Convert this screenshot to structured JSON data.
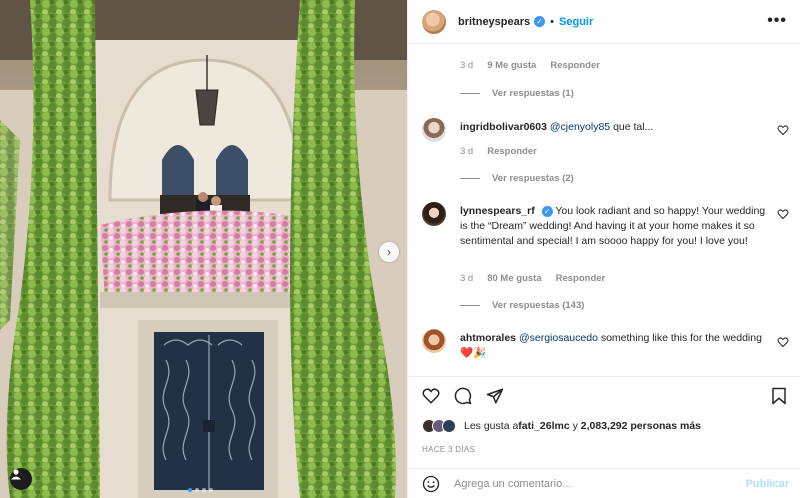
{
  "post": {
    "username": "britneyspears",
    "follow_label": "Seguir",
    "separator": "•",
    "more_label": "•••",
    "next_icon": "chevron-right-icon"
  },
  "comments": {
    "c0_meta": {
      "age": "3 d",
      "likes": "9 Me gusta",
      "reply": "Responder"
    },
    "c0_view_replies": "Ver respuestas (1)",
    "c1": {
      "username": "ingridbolivar0603",
      "mention": "@cjenyoly85",
      "text": " que tal...",
      "age": "3 d",
      "reply": "Responder",
      "view_replies": "Ver respuestas (2)"
    },
    "c2": {
      "username": "lynnespears_rf",
      "text": " You look radiant and so happy! Your wedding is the “Dream” wedding! And having it at your home makes it so sentimental and special! I am soooo happy for you! I love you!",
      "age": "3 d",
      "likes": "80 Me gusta",
      "reply": "Responder",
      "view_replies": "Ver respuestas (143)"
    },
    "c3": {
      "username": "ahtmorales",
      "mention": "@sergiosaucedo",
      "text": " something like this for the wedding ",
      "emoji": "❤️🎉"
    }
  },
  "likes": {
    "prefix": "Les gusta a ",
    "user": "fati_26lmc",
    "middle": " y ",
    "count": "2,083,292 personas más"
  },
  "posted_ago": "HACE 3 DÍAS",
  "add_comment": {
    "placeholder": "Agrega un comentario...",
    "publish_label": "Publicar"
  },
  "colors": {
    "accent": "#0095f6",
    "verified": "#3897f0",
    "publish_disabled": "#b2dffc",
    "muted": "#8e8e8e"
  }
}
